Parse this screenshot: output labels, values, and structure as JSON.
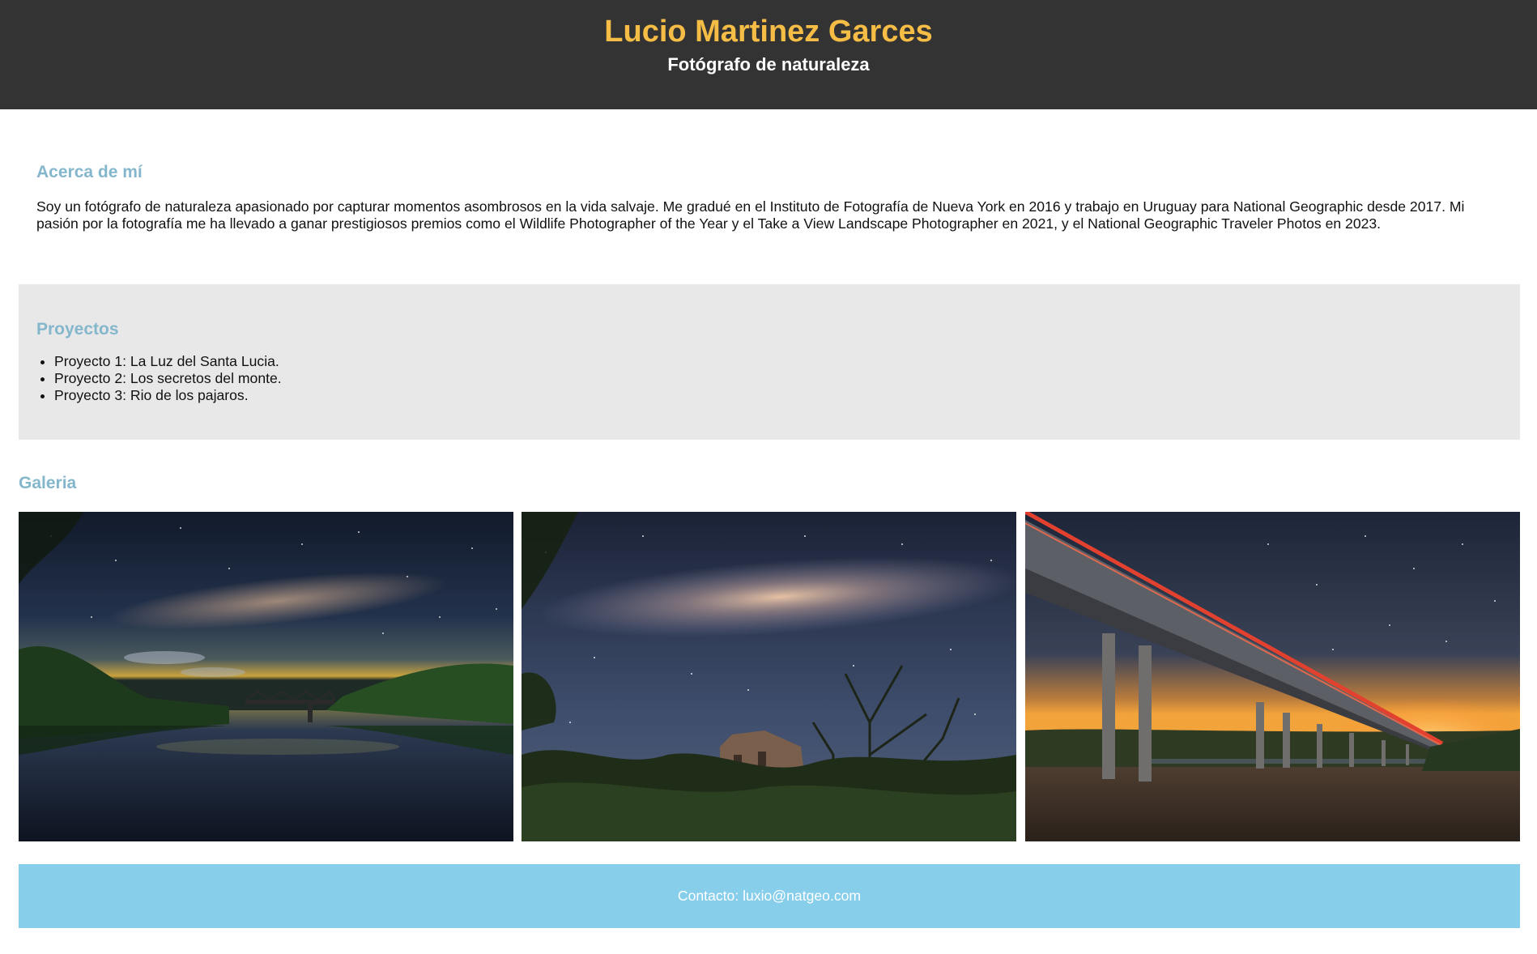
{
  "header": {
    "title": "Lucio Martinez Garces",
    "subtitle": "Fotógrafo de naturaleza"
  },
  "about": {
    "heading": "Acerca de mí",
    "text": "Soy un fotógrafo de naturaleza apasionado por capturar momentos asombrosos en la vida salvaje. Me gradué en el Instituto de Fotografía de Nueva York en 2016 y trabajo en Uruguay para National Geographic desde 2017. Mi pasión por la fotografía me ha llevado a ganar prestigiosos premios como el Wildlife Photographer of the Year y el Take a View Landscape Photographer en 2021, y el National Geographic Traveler Photos en 2023."
  },
  "projects": {
    "heading": "Proyectos",
    "items": [
      "Proyecto 1: La Luz del Santa Lucia.",
      "Proyecto 2: Los secretos del monte.",
      "Proyecto 3: Rio de los pajaros."
    ]
  },
  "gallery": {
    "heading": "Galeria",
    "photos": [
      {
        "subject": "river-bridge-milky-way-night"
      },
      {
        "subject": "milky-way-trees-ruin-night"
      },
      {
        "subject": "highway-bridge-light-trails-night"
      }
    ]
  },
  "footer": {
    "contact": "Contacto: luxio@natgeo.com"
  },
  "colors": {
    "header_bg": "#333333",
    "title": "#f6bd46",
    "heading": "#84b7cc",
    "projects_bg": "#e8e8e8",
    "footer_bg": "#87ceeb"
  }
}
